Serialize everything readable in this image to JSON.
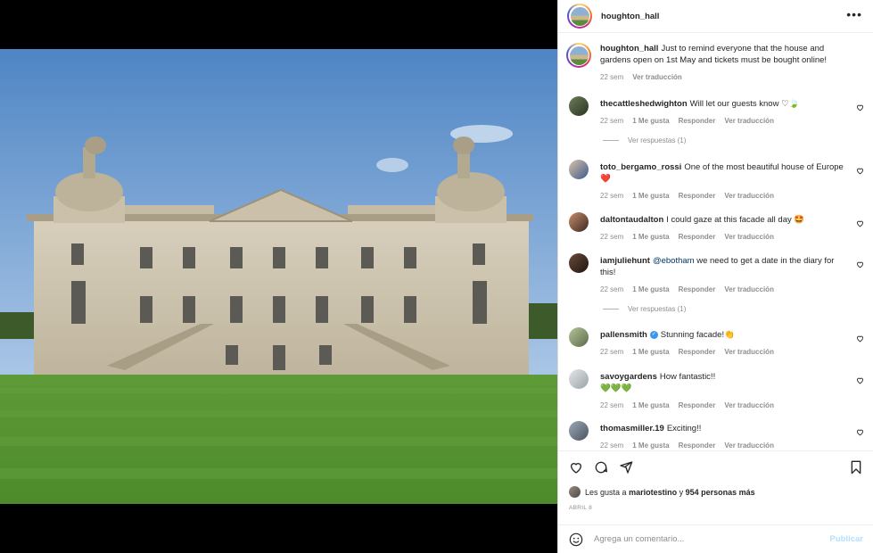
{
  "post": {
    "username": "houghton_hall",
    "caption_user": "houghton_hall",
    "caption_text": "Just to remind everyone that the house and gardens open on 1st May and tickets must be bought online!",
    "caption_time": "22 sem",
    "caption_translate": "Ver traducción"
  },
  "comments": [
    {
      "user": "thecattleshedwighton",
      "text": "Will let our guests know ♡🍃",
      "time": "22 sem",
      "likes": "1 Me gusta",
      "reply": "Responder",
      "translate": "Ver traducción"
    },
    {
      "user": "toto_bergamo_rossi",
      "text": "One of the most beautiful house of Europe ❤️",
      "time": "22 sem",
      "likes": "1 Me gusta",
      "reply": "Responder",
      "translate": "Ver traducción"
    },
    {
      "user": "daltontaudalton",
      "text": "I could gaze at this facade all day 🤩",
      "time": "22 sem",
      "likes": "1 Me gusta",
      "reply": "Responder",
      "translate": "Ver traducción"
    },
    {
      "user": "iamjuliehunt",
      "mention": "@ebotham",
      "text": " we need to get a date in the diary for this!",
      "time": "22 sem",
      "likes": "1 Me gusta",
      "reply": "Responder",
      "translate": "Ver traducción"
    },
    {
      "user": "pallensmith",
      "text": "Stunning facade!👏",
      "time": "22 sem",
      "likes": "1 Me gusta",
      "reply": "Responder",
      "translate": "Ver traducción"
    },
    {
      "user": "savoygardens",
      "text": "How fantastic!!",
      "text2": "💚💚💚",
      "time": "22 sem",
      "likes": "1 Me gusta",
      "reply": "Responder",
      "translate": "Ver traducción"
    },
    {
      "user": "thomasmiller.19",
      "text": "Exciting!!",
      "time": "22 sem",
      "likes": "1 Me gusta",
      "reply": "Responder",
      "translate": "Ver traducción"
    }
  ],
  "view_replies": "Ver respuestas (1)",
  "likes_line": {
    "prefix": "Les gusta a",
    "user": "mariotestino",
    "conj": "y",
    "others": "954 personas más"
  },
  "date": "ABRIL 8",
  "composer": {
    "placeholder": "Agrega un comentario...",
    "publish": "Publicar"
  },
  "icons": {
    "more": "more-horizontal-icon",
    "like": "heart-icon",
    "comment": "comment-icon",
    "share": "share-icon",
    "save": "bookmark-icon",
    "emoji": "emoji-icon"
  },
  "colors": {
    "link": "#00376b",
    "muted": "#8e8e8e",
    "verified": "#3897f0",
    "publish_disabled": "#b2dffc"
  }
}
